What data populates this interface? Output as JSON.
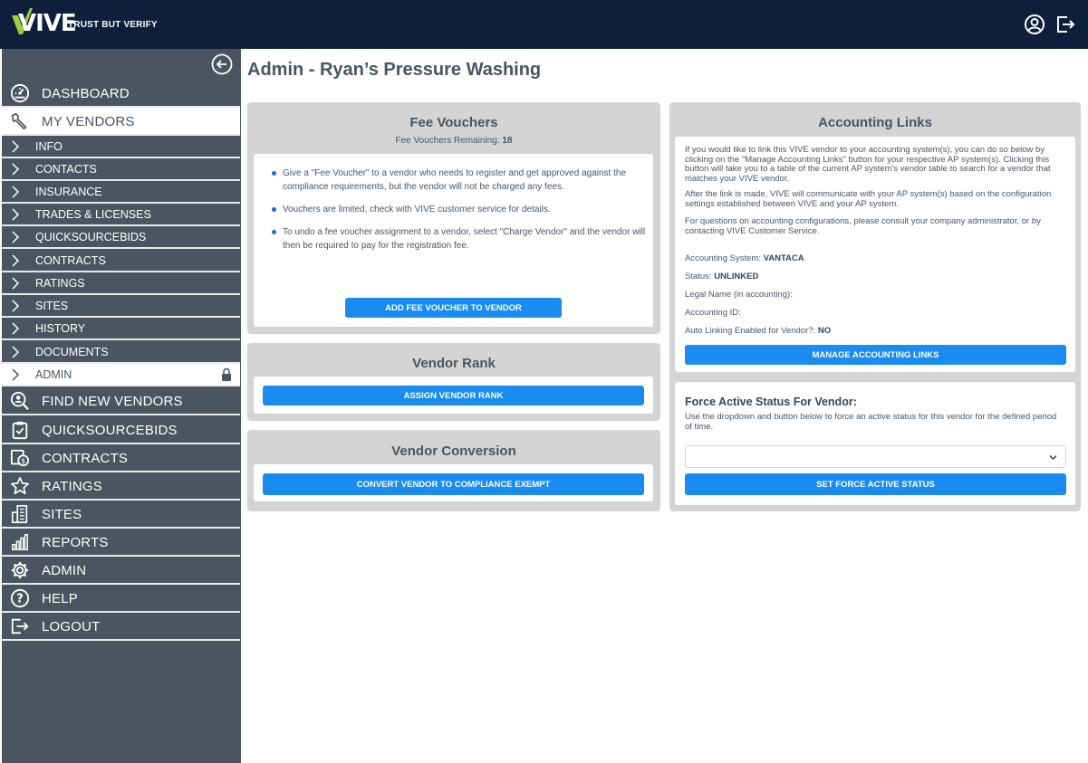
{
  "header": {
    "logo_text": "VIVE",
    "tagline": "TRUST BUT VERIFY",
    "icons": [
      "user-circle-icon",
      "logout-icon"
    ]
  },
  "sidebar": {
    "items": [
      {
        "label": "DASHBOARD",
        "icon": "dashboard-icon"
      },
      {
        "label": "MY VENDORS",
        "icon": "wrench-icon"
      },
      {
        "label": "INFO"
      },
      {
        "label": "CONTACTS"
      },
      {
        "label": "INSURANCE"
      },
      {
        "label": "TRADES & LICENSES"
      },
      {
        "label": "QUICKSOURCEBIDS"
      },
      {
        "label": "CONTRACTS"
      },
      {
        "label": "RATINGS"
      },
      {
        "label": "SITES"
      },
      {
        "label": "HISTORY"
      },
      {
        "label": "DOCUMENTS"
      },
      {
        "label": "ADMIN"
      },
      {
        "label": "FIND NEW VENDORS",
        "icon": "search-user-icon"
      },
      {
        "label": "QUICKSOURCEBIDS",
        "icon": "clipboard-icon"
      },
      {
        "label": "CONTRACTS",
        "icon": "contract-icon"
      },
      {
        "label": "RATINGS",
        "icon": "star-icon"
      },
      {
        "label": "SITES",
        "icon": "building-icon"
      },
      {
        "label": "REPORTS",
        "icon": "bar-chart-icon"
      },
      {
        "label": "ADMIN",
        "icon": "gear-icon"
      },
      {
        "label": "HELP",
        "icon": "help-icon"
      },
      {
        "label": "LOGOUT",
        "icon": "logout-icon"
      }
    ]
  },
  "page": {
    "title": "Admin - Ryan’s Pressure Washing"
  },
  "fee_vouchers": {
    "title": "Fee Vouchers",
    "remaining_label": "Fee Vouchers Remaining:",
    "remaining_value": "18",
    "bullets": [
      "Give a \"Fee Voucher\" to a vendor who needs to register and get approved against the compliance requirements, but the vendor will not be charged any fees.",
      "Vouchers are limited, check with VIVE customer service for details.",
      "To undo a fee voucher assignment to a vendor, select \"Charge Vendor\" and the vendor will then be required to pay for the registration fee."
    ],
    "button": "ADD FEE VOUCHER TO VENDOR"
  },
  "vendor_rank": {
    "title": "Vendor Rank",
    "button": "ASSIGN VENDOR RANK"
  },
  "vendor_conversion": {
    "title": "Vendor Conversion",
    "button": "CONVERT VENDOR TO COMPLIANCE EXEMPT"
  },
  "accounting_links": {
    "title": "Accounting Links",
    "paragraphs": [
      "If you would like to link this VIVE vendor to your accounting system(s), you can do so below by clicking on the \"Manage Accounting Links\" button for your respective AP system(s). Clicking this button will take you to a table of the current AP system's vendor table to search for a vendor that matches your VIVE vendor.",
      "After the link is made, VIVE will communicate with your AP system(s) based on the configuration settings established between VIVE and your AP system.",
      "For questions on accounting configurations, please consult your company administrator, or by contacting VIVE Customer Service."
    ],
    "fields": [
      {
        "label": "Accounting System:",
        "value": "VANTACA"
      },
      {
        "label": "Status:",
        "value": "UNLINKED"
      },
      {
        "label": "Legal Name (in accounting):",
        "value": ""
      },
      {
        "label": "Accounting ID:",
        "value": ""
      },
      {
        "label": "Auto Linking Enabled for Vendor?:",
        "value": "NO"
      }
    ],
    "button": "MANAGE ACCOUNTING LINKS"
  },
  "force_active": {
    "title": "Force Active Status For Vendor:",
    "description": "Use the dropdown and button below to force an active status for this vendor for the defined period of time.",
    "select_value": "",
    "button": "SET FORCE ACTIVE STATUS"
  },
  "colors": {
    "topbar": "#0d1f3a",
    "sidebar": "#4a5561",
    "accent": "#1a8cf0",
    "logo_green": "#9bd13a"
  }
}
